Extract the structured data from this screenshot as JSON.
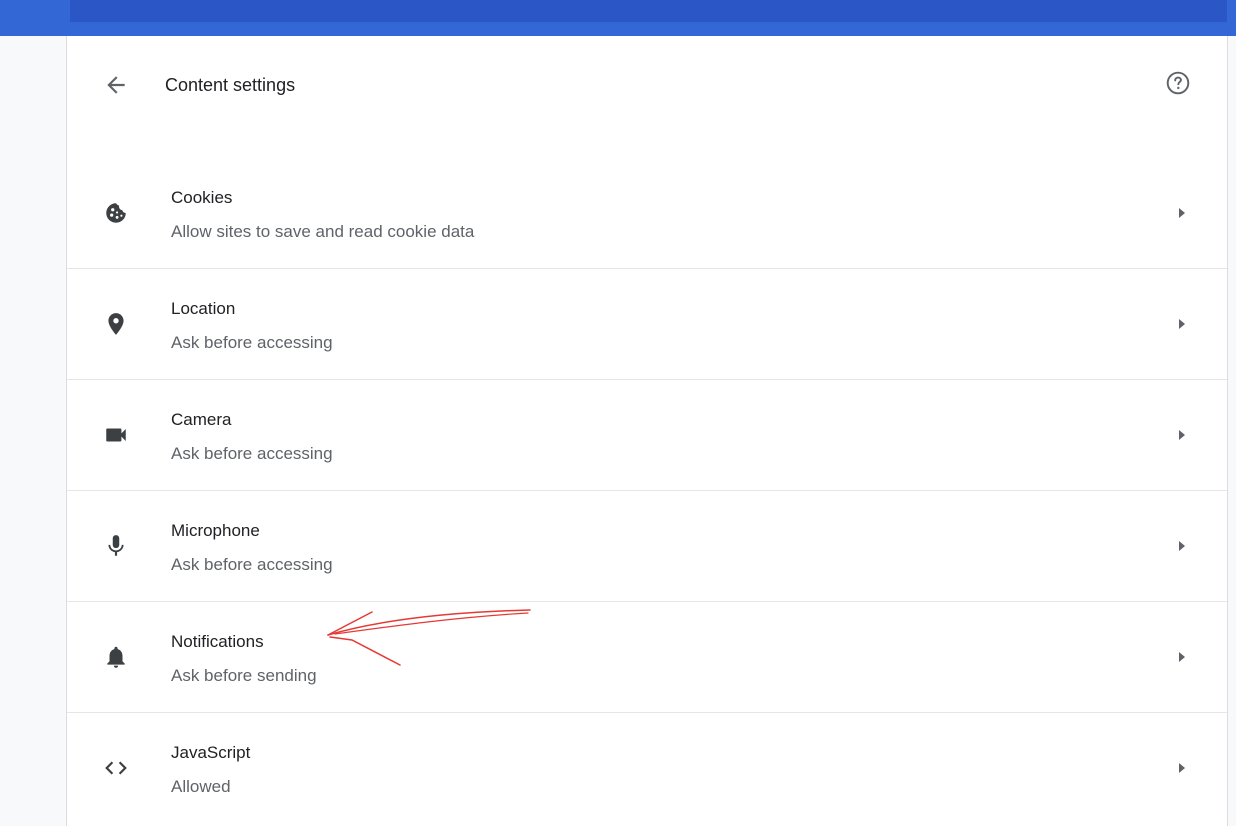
{
  "header": {
    "title": "Content settings",
    "back_icon": "arrow-back-icon",
    "help_icon": "help-circle-icon"
  },
  "settings": [
    {
      "icon": "cookie-icon",
      "title": "Cookies",
      "subtitle": "Allow sites to save and read cookie data"
    },
    {
      "icon": "location-pin-icon",
      "title": "Location",
      "subtitle": "Ask before accessing"
    },
    {
      "icon": "camera-icon",
      "title": "Camera",
      "subtitle": "Ask before accessing"
    },
    {
      "icon": "microphone-icon",
      "title": "Microphone",
      "subtitle": "Ask before accessing"
    },
    {
      "icon": "bell-icon",
      "title": "Notifications",
      "subtitle": "Ask before sending"
    },
    {
      "icon": "code-brackets-icon",
      "title": "JavaScript",
      "subtitle": "Allowed"
    }
  ],
  "colors": {
    "topbar": "#3367d6",
    "annotation": "#e53935",
    "icon": "#5f6368"
  }
}
